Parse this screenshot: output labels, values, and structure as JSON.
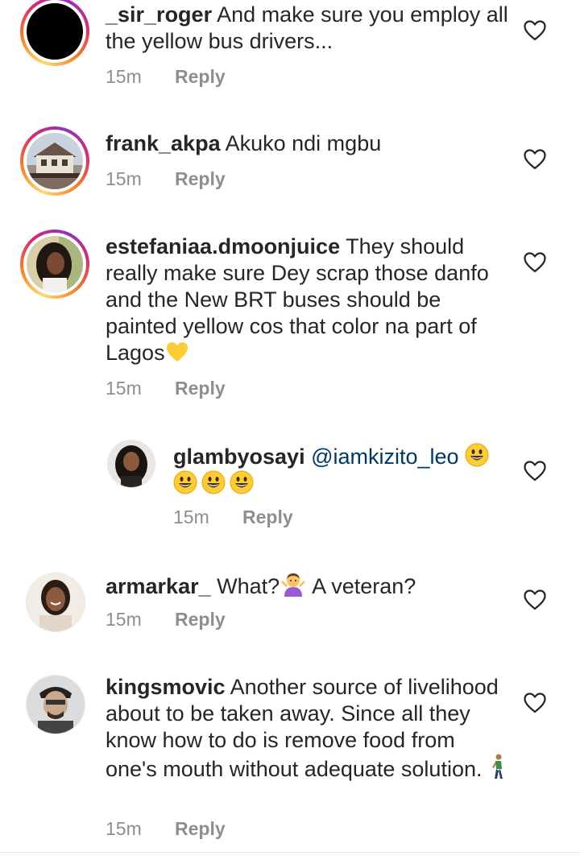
{
  "comments": [
    {
      "username": "_sir_roger",
      "text": " And make sure you employ all the yellow bus drivers...",
      "time": "15m",
      "reply_label": "Reply"
    },
    {
      "username": "frank_akpa",
      "text": " Akuko ndi mgbu",
      "time": "15m",
      "reply_label": "Reply"
    },
    {
      "username": "estefaniaa.dmoonjuice",
      "text": " They should really make sure Dey scrap those danfo and the New BRT buses should be painted yellow cos that color na part of Lagos",
      "time": "15m",
      "reply_label": "Reply"
    },
    {
      "username": "glambyosayi",
      "mention": "@iamkizito_leo",
      "time": "15m",
      "reply_label": "Reply"
    },
    {
      "username": "armarkar_",
      "text_before": " What?",
      "text_after": " A veteran?",
      "time": "15m",
      "reply_label": "Reply"
    },
    {
      "username": "kingsmovic",
      "text": " Another source of livelihood about to be taken away. Since all they know how to do is remove food from one's mouth without adequate solution. ",
      "time": "15m",
      "reply_label": "Reply"
    }
  ],
  "colors": {
    "text": "#262626",
    "secondary": "#8e8e8e",
    "mention": "#00376b",
    "story_ring": [
      "#feda75",
      "#fa7e1e",
      "#d62976",
      "#962fbf"
    ]
  },
  "icons": {
    "like": "heart-outline-icon",
    "emojis": [
      "yellow-heart-emoji",
      "grinning-face-emoji",
      "person-shrugging-emoji",
      "person-walking-emoji"
    ]
  }
}
